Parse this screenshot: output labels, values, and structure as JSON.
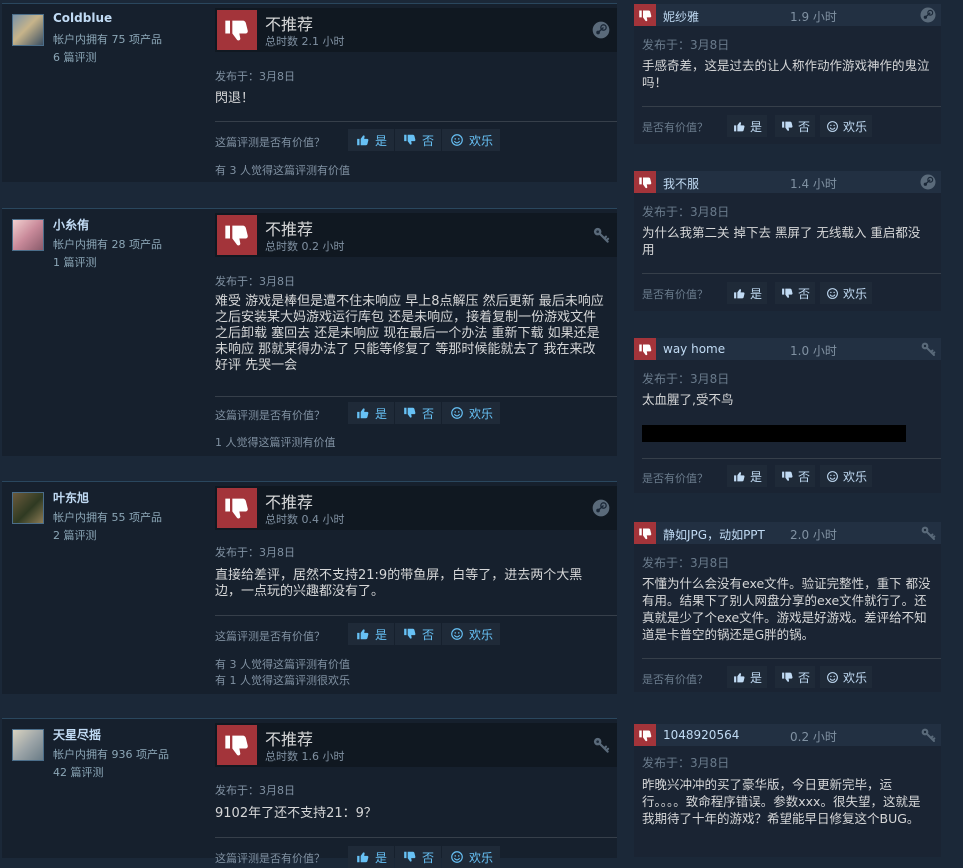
{
  "labels": {
    "not_recommended": "不推荐",
    "posted_prefix": "发布于：",
    "helpful_question": "这篇评测是否有价值？",
    "helpful_question_short": "是否有价值？",
    "yes": "是",
    "no": "否",
    "funny": "欢乐"
  },
  "colors": {
    "thumb_down_bg": "#a3343a",
    "link_blue": "#67c1f5",
    "page_bg": "#1b2838"
  },
  "left_reviews": [
    {
      "author": "Coldblue",
      "products": "帐户内拥有 75 项产品",
      "reviews": "6 篇评测",
      "hours": "总时数 2.1 小时",
      "posted": "发布于：3月8日",
      "text": "閃退！",
      "platform_icon": "steam-icon",
      "counts": [
        "有 3 人觉得这篇评测有价值"
      ]
    },
    {
      "author": "小糸侑",
      "products": "帐户内拥有 28 项产品",
      "reviews": "1 篇评测",
      "hours": "总时数 0.2 小时",
      "posted": "发布于：3月8日",
      "text": "难受 游戏是棒但是遭不住未响应 早上8点解压 然后更新 最后未响应之后安装某大妈游戏运行库包 还是未响应，接着复制一份游戏文件之后卸载 塞回去 还是未响应 现在最后一个办法 重新下载 如果还是未响应 那就某得办法了 只能等修复了 等那时候能就去了 我在来改好评 先哭一会",
      "platform_icon": "key-icon",
      "counts": [
        "1 人觉得这篇评测有价值"
      ]
    },
    {
      "author": "叶东旭",
      "products": "帐户内拥有 55 项产品",
      "reviews": "2 篇评测",
      "hours": "总时数 0.4 小时",
      "posted": "发布于：3月8日",
      "text": "直接给差评，居然不支持21:9的带鱼屏，白等了，进去两个大黑边，一点玩的兴趣都没有了。",
      "platform_icon": "steam-icon",
      "counts": [
        "有 3 人觉得这篇评测有价值",
        "有 1 人觉得这篇评测很欢乐"
      ]
    },
    {
      "author": "天星尽摇",
      "products": "帐户内拥有 936 项产品",
      "reviews": "42 篇评测",
      "hours": "总时数 1.6 小时",
      "posted": "发布于：3月8日",
      "text": "9102年了还不支持21：9？",
      "platform_icon": "key-icon",
      "counts": []
    }
  ],
  "right_reviews": [
    {
      "author": "妮纱雅",
      "hours": "1.9 小时",
      "posted": "发布于：3月8日",
      "text": "手感奇差，这是过去的让人称作动作游戏神作的鬼泣吗！",
      "platform_icon": "steam-icon"
    },
    {
      "author": "我不服",
      "hours": "1.4 小时",
      "posted": "发布于：3月8日",
      "text": "为什么我第二关 掉下去 黑屏了 无线载入 重启都没用",
      "platform_icon": "steam-icon"
    },
    {
      "author": "way home",
      "hours": "1.0 小时",
      "posted": "发布于：3月8日",
      "text": "太血腥了,受不鸟",
      "platform_icon": "key-icon"
    },
    {
      "author": "静如JPG，动如PPT",
      "hours": "2.0 小时",
      "posted": "发布于：3月8日",
      "text": "不懂为什么会没有exe文件。验证完整性，重下 都没有用。结果下了别人网盘分享的exe文件就行了。还真就是少了个exe文件。游戏是好游戏。差评给不知道是卡普空的锅还是G胖的锅。",
      "platform_icon": "key-icon"
    },
    {
      "author": "1048920564",
      "hours": "0.2 小时",
      "posted": "发布于：3月8日",
      "text": "昨晚兴冲冲的买了豪华版，今日更新完毕，运行。。。。致命程序错误。参数xxx。很失望，这就是我期待了十年的游戏？希望能早日修复这个BUG。",
      "platform_icon": "key-icon"
    }
  ]
}
